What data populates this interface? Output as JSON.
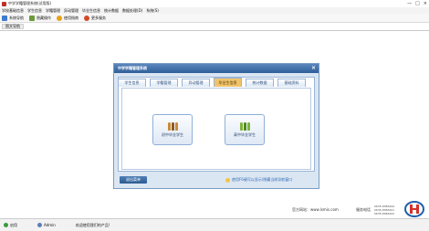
{
  "window": {
    "title": "中学学籍管理系统(试用版)",
    "controls": [
      "—",
      "□",
      "×"
    ]
  },
  "menu": [
    "学校基础信息",
    "学生信息",
    "学籍管理",
    "异动管理",
    "毕业生信息",
    "统计数据",
    "数据处理(D)",
    "系统(S)"
  ],
  "toolbar": {
    "items": [
      {
        "label": "系统导航",
        "icon": "navigation-icon"
      },
      {
        "label": "隐藏操作",
        "icon": "hide-icon"
      },
      {
        "label": "使用指南",
        "icon": "help-icon"
      },
      {
        "label": "更多服务",
        "icon": "service-icon"
      }
    ]
  },
  "nav_tab": {
    "label": "图文导航"
  },
  "dialog": {
    "title": "中学学籍管理系统",
    "tabs": [
      "学生信息",
      "学籍管理",
      "异动管理",
      "毕业生信息",
      "统计数据",
      "基础资料"
    ],
    "active_tab": "毕业生信息",
    "buttons": [
      "初中毕业学生",
      "高中毕业学生"
    ],
    "return_label": "退出菜单",
    "tip": "使用F6键可以显示/隐藏当前导航窗口"
  },
  "footer": {
    "website": "官方网站：www.lsmis.com",
    "phone_label": "服务电话",
    "phones": [
      "0635-8386200",
      "0635-8386201",
      "0635-8386202"
    ]
  },
  "statusbar": {
    "items": [
      "启用",
      "Admin",
      "欢迎使用我们的产品!"
    ]
  },
  "colors": {
    "accent": "#2f5f99",
    "active_tab": "#f0c36a",
    "link": "#3069b3"
  }
}
